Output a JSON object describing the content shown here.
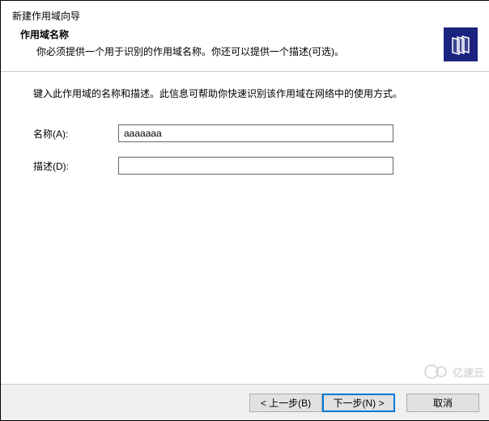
{
  "window": {
    "title": "新建作用域向导"
  },
  "header": {
    "heading": "作用域名称",
    "subtext": "你必须提供一个用于识别的作用域名称。你还可以提供一个描述(可选)。"
  },
  "content": {
    "instruction": "键入此作用域的名称和描述。此信息可帮助你快速识别该作用域在网络中的使用方式。"
  },
  "form": {
    "name": {
      "label": "名称(A):",
      "value": "aaaaaaa"
    },
    "description": {
      "label": "描述(D):",
      "value": ""
    }
  },
  "buttons": {
    "back": "< 上一步(B)",
    "next": "下一步(N) >",
    "cancel": "取消"
  },
  "watermark": {
    "text": "亿速云"
  }
}
